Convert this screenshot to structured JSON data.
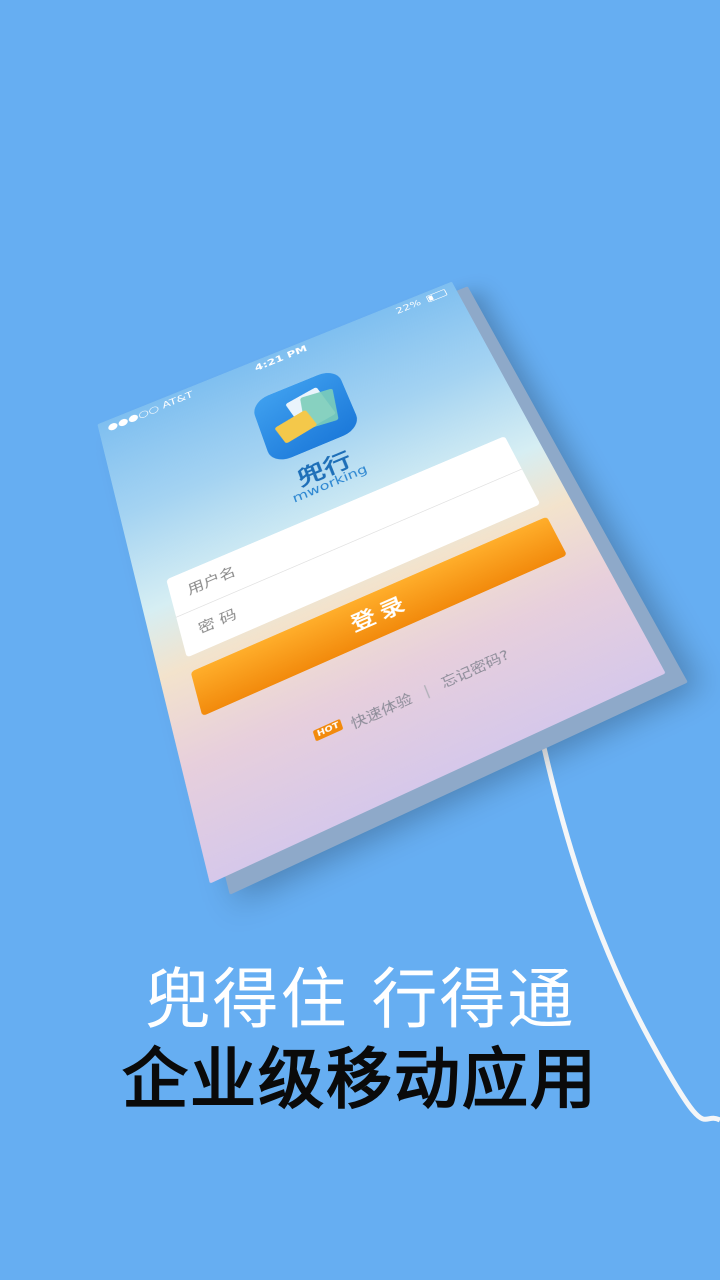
{
  "phone": {
    "status": {
      "carrier": "●●●○○ AT&T",
      "time": "4:21 PM",
      "battery": "22%"
    },
    "app": {
      "name": "兜行",
      "subtitle": "mworking"
    },
    "form": {
      "username_placeholder": "用户名",
      "password_placeholder": "密  码"
    },
    "login_label": "登录",
    "links": {
      "hot_badge": "HOT",
      "quick_trial": "快速体验",
      "separator": "|",
      "forgot_password": "忘记密码?"
    }
  },
  "promo": {
    "tagline": "兜得住 行得通",
    "headline": "企业级移动应用"
  },
  "colors": {
    "background": "#66aef2",
    "login_button": "#f28a0c",
    "brand_blue": "#1e6fb8"
  }
}
